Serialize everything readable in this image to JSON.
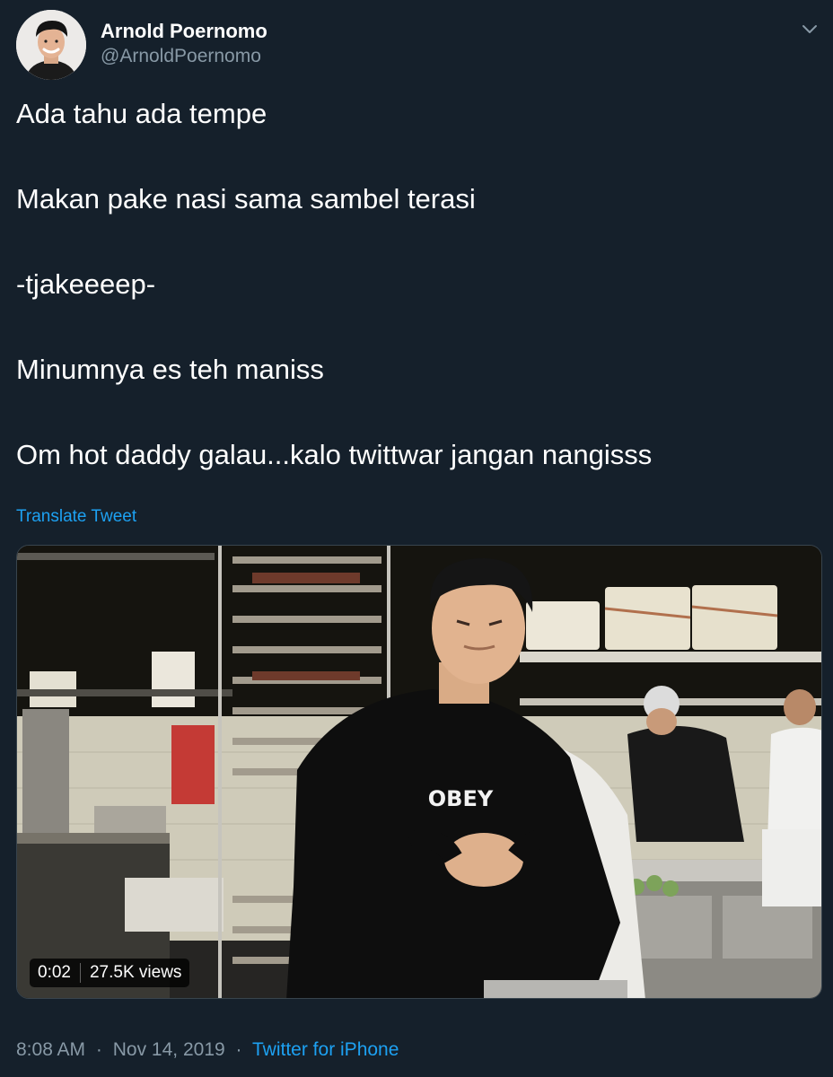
{
  "author": {
    "display_name": "Arnold Poernomo",
    "handle": "@ArnoldPoernomo",
    "avatar_icon": "profile-photo"
  },
  "menu_icon": "chevron-down-icon",
  "tweet": {
    "lines": [
      "Ada tahu ada tempe",
      "Makan pake nasi sama sambel terasi",
      "-tjakeeeep-",
      "Minumnya es teh maniss",
      "Om hot daddy galau...kalo twittwar jangan nangisss"
    ],
    "translate_label": "Translate Tweet"
  },
  "media": {
    "type": "video",
    "duration": "0:02",
    "views": "27.5K views",
    "shirt_text": "OBEY"
  },
  "footer": {
    "time": "8:08 AM",
    "separator": "·",
    "date": "Nov 14, 2019",
    "source": "Twitter for iPhone"
  },
  "colors": {
    "background": "#15202b",
    "text_primary": "#ffffff",
    "text_secondary": "#8899a6",
    "link": "#1da1f2"
  }
}
